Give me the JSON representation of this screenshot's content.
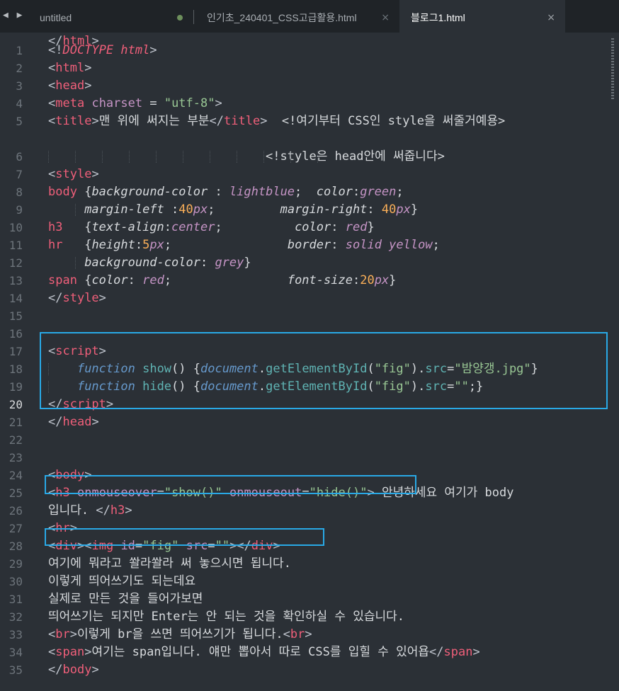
{
  "tabbar": {
    "nav_arrows": "◀ ▶",
    "tabs": [
      {
        "label": "untitled",
        "modified": true,
        "active": false
      },
      {
        "label": "인기초_240401_CSS고급활용.html",
        "close": "×",
        "active": false
      },
      {
        "label": "블로그1.html",
        "close": "×",
        "active": true
      }
    ]
  },
  "editor": {
    "current_line": 20,
    "line_numbers": [
      "1",
      "2",
      "3",
      "4",
      "5",
      "6",
      "7",
      "8",
      "9",
      "10",
      "11",
      "12",
      "13",
      "14",
      "15",
      "16",
      "17",
      "18",
      "19",
      "20",
      "21",
      "22",
      "23",
      "24",
      "25",
      "26",
      "27",
      "28",
      "29",
      "30",
      "31",
      "32",
      "33",
      "34",
      "35"
    ],
    "lines": [
      [
        [
          "<!",
          "t"
        ],
        [
          "DOCTYPE",
          "k"
        ],
        [
          " ",
          ""
        ],
        [
          "html",
          "k"
        ],
        [
          ">",
          "t"
        ]
      ],
      [
        [
          "<",
          "t"
        ],
        [
          "html",
          "tg"
        ],
        [
          ">",
          "t"
        ]
      ],
      [
        [
          "<",
          "t"
        ],
        [
          "head",
          "tg"
        ],
        [
          ">",
          "t"
        ]
      ],
      [
        [
          "<",
          "t"
        ],
        [
          "meta",
          "tg"
        ],
        [
          " ",
          ""
        ],
        [
          "charset",
          "at"
        ],
        [
          " = ",
          ""
        ],
        [
          "\"utf-8\"",
          "s"
        ],
        [
          ">",
          "t"
        ]
      ],
      [
        [
          "<",
          "t"
        ],
        [
          "title",
          "tg"
        ],
        [
          ">",
          "t"
        ],
        [
          "맨 위에 써지는 부분",
          ""
        ],
        [
          "</",
          "t"
        ],
        [
          "title",
          "tg"
        ],
        [
          ">",
          "t"
        ],
        [
          "  <!여기부터 CSS인 style을 써줄거예용>",
          ""
        ]
      ],
      [
        [
          "                              <!style은 head안에 써줍니다>",
          ""
        ]
      ],
      [
        [
          "<",
          "t"
        ],
        [
          "style",
          "tg"
        ],
        [
          ">",
          "t"
        ]
      ],
      [
        [
          "body",
          "tg"
        ],
        [
          " {",
          ""
        ],
        [
          "background-color",
          "pi"
        ],
        [
          " : ",
          ""
        ],
        [
          "lightblue",
          "vi"
        ],
        [
          ";  ",
          ""
        ],
        [
          "color",
          "pi"
        ],
        [
          ":",
          ""
        ],
        [
          "green",
          "vi"
        ],
        [
          ";",
          ""
        ]
      ],
      [
        [
          "     ",
          ""
        ],
        [
          "margin-left",
          "pi"
        ],
        [
          " :",
          ""
        ],
        [
          "40",
          "n"
        ],
        [
          "px",
          "vi"
        ],
        [
          ";         ",
          ""
        ],
        [
          "margin-right",
          "pi"
        ],
        [
          ": ",
          ""
        ],
        [
          "40",
          "n"
        ],
        [
          "px",
          "vi"
        ],
        [
          "}",
          ""
        ]
      ],
      [
        [
          "h3",
          "tg"
        ],
        [
          "   {",
          ""
        ],
        [
          "text-align",
          "pi"
        ],
        [
          ":",
          ""
        ],
        [
          "center",
          "vi"
        ],
        [
          ";          ",
          ""
        ],
        [
          "color",
          "pi"
        ],
        [
          ": ",
          ""
        ],
        [
          "red",
          "vi"
        ],
        [
          "}",
          ""
        ]
      ],
      [
        [
          "hr",
          "tg"
        ],
        [
          "   {",
          ""
        ],
        [
          "height",
          "pi"
        ],
        [
          ":",
          ""
        ],
        [
          "5",
          "n"
        ],
        [
          "px",
          "vi"
        ],
        [
          ";                ",
          ""
        ],
        [
          "border",
          "pi"
        ],
        [
          ": ",
          ""
        ],
        [
          "solid yellow",
          "vi"
        ],
        [
          ";",
          ""
        ]
      ],
      [
        [
          "     ",
          ""
        ],
        [
          "background-color",
          "pi"
        ],
        [
          ": ",
          ""
        ],
        [
          "grey",
          "vi"
        ],
        [
          "}",
          ""
        ]
      ],
      [
        [
          "span",
          "tg"
        ],
        [
          " {",
          ""
        ],
        [
          "color",
          "pi"
        ],
        [
          ": ",
          ""
        ],
        [
          "red",
          "vi"
        ],
        [
          ";                ",
          ""
        ],
        [
          "font-size",
          "pi"
        ],
        [
          ":",
          ""
        ],
        [
          "20",
          "n"
        ],
        [
          "px",
          "vi"
        ],
        [
          "}",
          ""
        ]
      ],
      [
        [
          "</",
          "t"
        ],
        [
          "style",
          "tg"
        ],
        [
          ">",
          "t"
        ]
      ],
      [],
      [],
      [
        [
          "<",
          "t"
        ],
        [
          "script",
          "tg"
        ],
        [
          ">",
          "t"
        ]
      ],
      [
        [
          "    ",
          ""
        ],
        [
          "function",
          "kb"
        ],
        [
          " ",
          ""
        ],
        [
          "show",
          "fn"
        ],
        [
          "() {",
          ""
        ],
        [
          "document",
          "kb"
        ],
        [
          ".",
          ""
        ],
        [
          "getElementById",
          "fn"
        ],
        [
          "(",
          ""
        ],
        [
          "\"fig\"",
          "s"
        ],
        [
          ").",
          ""
        ],
        [
          "src",
          "fn"
        ],
        [
          "=",
          ""
        ],
        [
          "\"밤양갱.jpg\"",
          "s"
        ],
        [
          "}",
          ""
        ]
      ],
      [
        [
          "    ",
          ""
        ],
        [
          "function",
          "kb"
        ],
        [
          " ",
          ""
        ],
        [
          "hide",
          "fn"
        ],
        [
          "() {",
          ""
        ],
        [
          "document",
          "kb"
        ],
        [
          ".",
          ""
        ],
        [
          "getElementById",
          "fn"
        ],
        [
          "(",
          ""
        ],
        [
          "\"fig\"",
          "s"
        ],
        [
          ").",
          ""
        ],
        [
          "src",
          "fn"
        ],
        [
          "=",
          ""
        ],
        [
          "\"\"",
          "s"
        ],
        [
          ";}",
          ""
        ]
      ],
      [
        [
          "</",
          "t"
        ],
        [
          "script",
          "tg"
        ],
        [
          ">",
          "t"
        ]
      ],
      [
        [
          "</",
          "t"
        ],
        [
          "head",
          "tg"
        ],
        [
          ">",
          "t"
        ]
      ],
      [],
      [],
      [
        [
          "<",
          "t"
        ],
        [
          "body",
          "tg"
        ],
        [
          ">",
          "t"
        ]
      ],
      [
        [
          "<",
          "t"
        ],
        [
          "h3",
          "tg"
        ],
        [
          " ",
          ""
        ],
        [
          "onmouseover",
          "at"
        ],
        [
          "=",
          ""
        ],
        [
          "\"show()\"",
          "s"
        ],
        [
          " ",
          ""
        ],
        [
          "onmouseout",
          "at"
        ],
        [
          "=",
          ""
        ],
        [
          "\"hide()\"",
          "s"
        ],
        [
          ">",
          "t"
        ],
        [
          " 안녕하세요 여기가 body",
          ""
        ]
      ],
      [
        [
          "입니다. ",
          ""
        ],
        [
          "</",
          "t"
        ],
        [
          "h3",
          "tg"
        ],
        [
          ">",
          "t"
        ]
      ],
      [
        [
          "<",
          "t"
        ],
        [
          "hr",
          "tg"
        ],
        [
          ">",
          "t"
        ]
      ],
      [
        [
          "<",
          "t"
        ],
        [
          "div",
          "tg"
        ],
        [
          ">",
          "t"
        ],
        [
          "<",
          "t"
        ],
        [
          "img",
          "tg"
        ],
        [
          " ",
          ""
        ],
        [
          "id",
          "at"
        ],
        [
          "=",
          ""
        ],
        [
          "\"fig\"",
          "s"
        ],
        [
          " ",
          ""
        ],
        [
          "src",
          "at"
        ],
        [
          "=",
          ""
        ],
        [
          "\"\"",
          "s"
        ],
        [
          ">",
          "t"
        ],
        [
          "</",
          "t"
        ],
        [
          "div",
          "tg"
        ],
        [
          ">",
          "t"
        ]
      ],
      [
        [
          "여기에 뭐라고 쏼라쏼라 써 놓으시면 됩니다.",
          ""
        ]
      ],
      [
        [
          "이렇게 띄어쓰기도 되는데요",
          ""
        ]
      ],
      [
        [
          "실제로 만든 것을 들어가보면",
          ""
        ]
      ],
      [
        [
          "띄어쓰기는 되지만 Enter는 안 되는 것을 확인하실 수 있습니다.",
          ""
        ]
      ],
      [
        [
          "<",
          "t"
        ],
        [
          "br",
          "tg"
        ],
        [
          ">",
          "t"
        ],
        [
          "이렇게 br을 쓰면 띄어쓰기가 됩니다.",
          ""
        ],
        [
          "<",
          "t"
        ],
        [
          "br",
          "tg"
        ],
        [
          ">",
          "t"
        ]
      ],
      [
        [
          "<",
          "t"
        ],
        [
          "span",
          "tg"
        ],
        [
          ">",
          "t"
        ],
        [
          "여기는 span입니다. 얘만 뽑아서 따로 CSS를 입힐 수 있어욥",
          ""
        ],
        [
          "</",
          "t"
        ],
        [
          "span",
          "tg"
        ],
        [
          ">",
          "t"
        ]
      ],
      [
        [
          "</",
          "t"
        ],
        [
          "body",
          "tg"
        ],
        [
          ">",
          "t"
        ]
      ],
      [
        [
          "</",
          "t"
        ],
        [
          "html",
          "tg"
        ],
        [
          ">",
          "t"
        ]
      ]
    ]
  },
  "colors": {
    "background": "#2b3036",
    "tabbar_bg": "#1f2327",
    "tag": "#f05f7a",
    "punctuation": "#c0c5ce",
    "attribute": "#c594c5",
    "string": "#99c794",
    "keyword_italic": "#6699cc",
    "function": "#5fb3b3",
    "number": "#f9ae58",
    "highlight_box": "#29a9e6"
  }
}
